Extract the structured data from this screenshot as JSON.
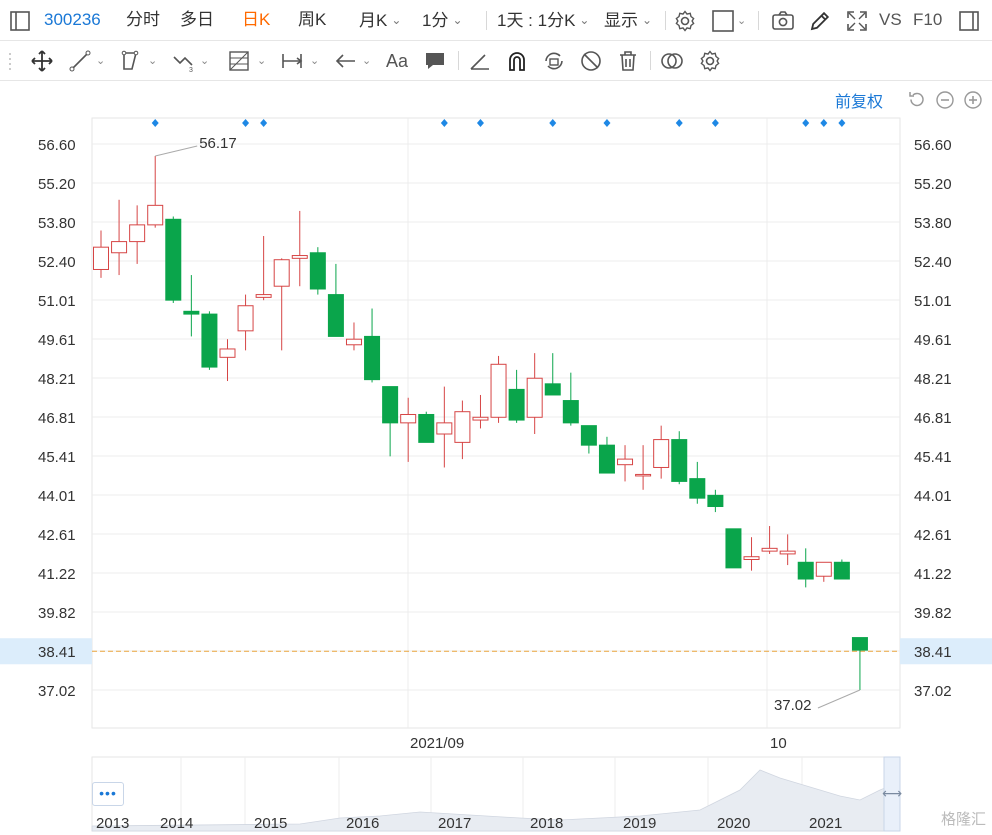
{
  "toolbar": {
    "stock_code": "300236",
    "tabs": [
      "分时",
      "多日",
      "日K",
      "周K",
      "月K"
    ],
    "active_tab": "日K",
    "minute_select": "1分",
    "range_select": "1天 : 1分K",
    "display_select": "显示",
    "vs_label": "VS",
    "f10_label": "F10"
  },
  "chart_toolbar": {
    "text_tool": "Aa"
  },
  "chart": {
    "adjust_label": "前复权",
    "colors": {
      "up": "#d64545",
      "down": "#0aa54b",
      "grid": "#ececec",
      "axis_text": "#333333",
      "highlight_bg": "#dcedfb",
      "current_line": "#e8a33d",
      "marker": "#1e88e5"
    },
    "y_ticks": [
      "56.60",
      "55.20",
      "53.80",
      "52.40",
      "51.01",
      "49.61",
      "48.21",
      "46.81",
      "45.41",
      "44.01",
      "42.61",
      "41.22",
      "39.82",
      "38.41",
      "37.02"
    ],
    "current_price": "38.41",
    "x_labels": [
      "2021/09",
      "10"
    ],
    "high_label": "56.17",
    "low_label": "37.02"
  },
  "chart_data": {
    "type": "candlestick",
    "ylim": [
      36.3,
      57.3
    ],
    "candles": [
      {
        "o": 52.1,
        "c": 52.9,
        "h": 53.5,
        "l": 51.8
      },
      {
        "o": 52.7,
        "c": 53.1,
        "h": 54.6,
        "l": 51.9
      },
      {
        "o": 53.1,
        "c": 53.7,
        "h": 54.4,
        "l": 52.3
      },
      {
        "o": 53.7,
        "c": 54.4,
        "h": 56.17,
        "l": 53.6
      },
      {
        "o": 53.9,
        "c": 51.0,
        "h": 54.0,
        "l": 50.9
      },
      {
        "o": 50.6,
        "c": 50.5,
        "h": 51.9,
        "l": 49.7
      },
      {
        "o": 50.5,
        "c": 48.6,
        "h": 50.6,
        "l": 48.5
      },
      {
        "o": 48.95,
        "c": 49.25,
        "h": 49.6,
        "l": 48.1
      },
      {
        "o": 49.9,
        "c": 50.8,
        "h": 51.2,
        "l": 49.2
      },
      {
        "o": 51.1,
        "c": 51.2,
        "h": 53.3,
        "l": 51.0
      },
      {
        "o": 51.5,
        "c": 52.45,
        "h": 52.5,
        "l": 49.2
      },
      {
        "o": 52.5,
        "c": 52.6,
        "h": 54.2,
        "l": 51.5
      },
      {
        "o": 52.7,
        "c": 51.4,
        "h": 52.9,
        "l": 51.2
      },
      {
        "o": 51.2,
        "c": 49.7,
        "h": 52.3,
        "l": 49.7
      },
      {
        "o": 49.4,
        "c": 49.6,
        "h": 50.2,
        "l": 49.2
      },
      {
        "o": 49.7,
        "c": 48.15,
        "h": 50.7,
        "l": 48.05
      },
      {
        "o": 47.9,
        "c": 46.6,
        "h": 47.9,
        "l": 45.4
      },
      {
        "o": 46.6,
        "c": 46.9,
        "h": 47.5,
        "l": 45.2
      },
      {
        "o": 46.9,
        "c": 45.9,
        "h": 47.0,
        "l": 45.9
      },
      {
        "o": 46.2,
        "c": 46.6,
        "h": 47.9,
        "l": 45.0
      },
      {
        "o": 45.9,
        "c": 47.0,
        "h": 47.4,
        "l": 45.3
      },
      {
        "o": 46.7,
        "c": 46.8,
        "h": 47.6,
        "l": 46.4
      },
      {
        "o": 46.8,
        "c": 48.7,
        "h": 49.0,
        "l": 46.6
      },
      {
        "o": 47.8,
        "c": 46.7,
        "h": 48.5,
        "l": 46.6
      },
      {
        "o": 46.8,
        "c": 48.2,
        "h": 49.1,
        "l": 46.2
      },
      {
        "o": 48.0,
        "c": 47.6,
        "h": 49.1,
        "l": 47.6
      },
      {
        "o": 47.4,
        "c": 46.6,
        "h": 48.4,
        "l": 46.5
      },
      {
        "o": 46.5,
        "c": 45.8,
        "h": 46.5,
        "l": 45.5
      },
      {
        "o": 45.8,
        "c": 44.8,
        "h": 46.1,
        "l": 44.8
      },
      {
        "o": 45.1,
        "c": 45.3,
        "h": 45.8,
        "l": 44.5
      },
      {
        "o": 44.7,
        "c": 44.75,
        "h": 45.8,
        "l": 44.2
      },
      {
        "o": 45.0,
        "c": 46.0,
        "h": 46.5,
        "l": 44.6
      },
      {
        "o": 46.0,
        "c": 44.5,
        "h": 46.3,
        "l": 44.4
      },
      {
        "o": 44.6,
        "c": 43.9,
        "h": 45.2,
        "l": 43.7
      },
      {
        "o": 44.0,
        "c": 43.6,
        "h": 44.2,
        "l": 43.4
      },
      {
        "o": 42.8,
        "c": 41.4,
        "h": 42.8,
        "l": 41.4
      },
      {
        "o": 41.7,
        "c": 41.8,
        "h": 42.5,
        "l": 41.3
      },
      {
        "o": 42.0,
        "c": 42.1,
        "h": 42.9,
        "l": 41.9
      },
      {
        "o": 41.9,
        "c": 42.0,
        "h": 42.6,
        "l": 41.5
      },
      {
        "o": 41.6,
        "c": 41.0,
        "h": 42.1,
        "l": 40.7
      },
      {
        "o": 41.1,
        "c": 41.6,
        "h": 41.6,
        "l": 40.9
      },
      {
        "o": 41.6,
        "c": 41.0,
        "h": 41.7,
        "l": 41.0
      },
      {
        "o": 38.9,
        "c": 38.45,
        "h": 38.9,
        "l": 37.02
      }
    ],
    "markers": [
      3,
      8,
      9,
      19,
      21,
      25,
      28,
      32,
      34,
      39,
      40,
      41
    ]
  },
  "navigator": {
    "year_labels": [
      "2013",
      "2014",
      "2015",
      "2016",
      "2017",
      "2018",
      "2019",
      "2020",
      "2021"
    ],
    "dots_label": "•••",
    "watermark": "格隆汇"
  }
}
